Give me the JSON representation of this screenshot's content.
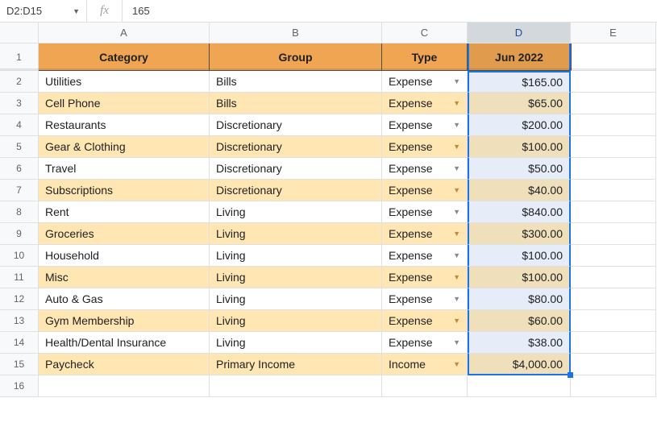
{
  "nameBox": "D2:D15",
  "fxLabel": "fx",
  "formulaValue": "165",
  "columns": [
    "A",
    "B",
    "C",
    "D",
    "E"
  ],
  "selectedColIndex": 3,
  "headers": {
    "category": "Category",
    "group": "Group",
    "type": "Type",
    "month": "Jun 2022"
  },
  "rows": [
    {
      "category": "Utilities",
      "group": "Bills",
      "type": "Expense",
      "amount": "$165.00",
      "alt": false
    },
    {
      "category": "Cell Phone",
      "group": "Bills",
      "type": "Expense",
      "amount": "$65.00",
      "alt": true
    },
    {
      "category": "Restaurants",
      "group": "Discretionary",
      "type": "Expense",
      "amount": "$200.00",
      "alt": false
    },
    {
      "category": "Gear & Clothing",
      "group": "Discretionary",
      "type": "Expense",
      "amount": "$100.00",
      "alt": true
    },
    {
      "category": "Travel",
      "group": "Discretionary",
      "type": "Expense",
      "amount": "$50.00",
      "alt": false
    },
    {
      "category": "Subscriptions",
      "group": "Discretionary",
      "type": "Expense",
      "amount": "$40.00",
      "alt": true
    },
    {
      "category": "Rent",
      "group": "Living",
      "type": "Expense",
      "amount": "$840.00",
      "alt": false
    },
    {
      "category": "Groceries",
      "group": "Living",
      "type": "Expense",
      "amount": "$300.00",
      "alt": true
    },
    {
      "category": "Household",
      "group": "Living",
      "type": "Expense",
      "amount": "$100.00",
      "alt": false
    },
    {
      "category": "Misc",
      "group": "Living",
      "type": "Expense",
      "amount": "$100.00",
      "alt": true
    },
    {
      "category": "Auto & Gas",
      "group": "Living",
      "type": "Expense",
      "amount": "$80.00",
      "alt": false
    },
    {
      "category": "Gym Membership",
      "group": "Living",
      "type": "Expense",
      "amount": "$60.00",
      "alt": true
    },
    {
      "category": "Health/Dental Insurance",
      "group": "Living",
      "type": "Expense",
      "amount": "$38.00",
      "alt": false
    },
    {
      "category": "Paycheck",
      "group": "Primary Income",
      "type": "Income",
      "amount": "$4,000.00",
      "alt": true
    }
  ],
  "emptyRowIndex": 16,
  "chart_data": {
    "type": "table",
    "columns": [
      "Category",
      "Group",
      "Type",
      "Jun 2022"
    ],
    "rows": [
      [
        "Utilities",
        "Bills",
        "Expense",
        165.0
      ],
      [
        "Cell Phone",
        "Bills",
        "Expense",
        65.0
      ],
      [
        "Restaurants",
        "Discretionary",
        "Expense",
        200.0
      ],
      [
        "Gear & Clothing",
        "Discretionary",
        "Expense",
        100.0
      ],
      [
        "Travel",
        "Discretionary",
        "Expense",
        50.0
      ],
      [
        "Subscriptions",
        "Discretionary",
        "Expense",
        40.0
      ],
      [
        "Rent",
        "Living",
        "Expense",
        840.0
      ],
      [
        "Groceries",
        "Living",
        "Expense",
        300.0
      ],
      [
        "Household",
        "Living",
        "Expense",
        100.0
      ],
      [
        "Misc",
        "Living",
        "Expense",
        100.0
      ],
      [
        "Auto & Gas",
        "Living",
        "Expense",
        80.0
      ],
      [
        "Gym Membership",
        "Living",
        "Expense",
        60.0
      ],
      [
        "Health/Dental Insurance",
        "Living",
        "Expense",
        38.0
      ],
      [
        "Paycheck",
        "Primary Income",
        "Income",
        4000.0
      ]
    ]
  }
}
